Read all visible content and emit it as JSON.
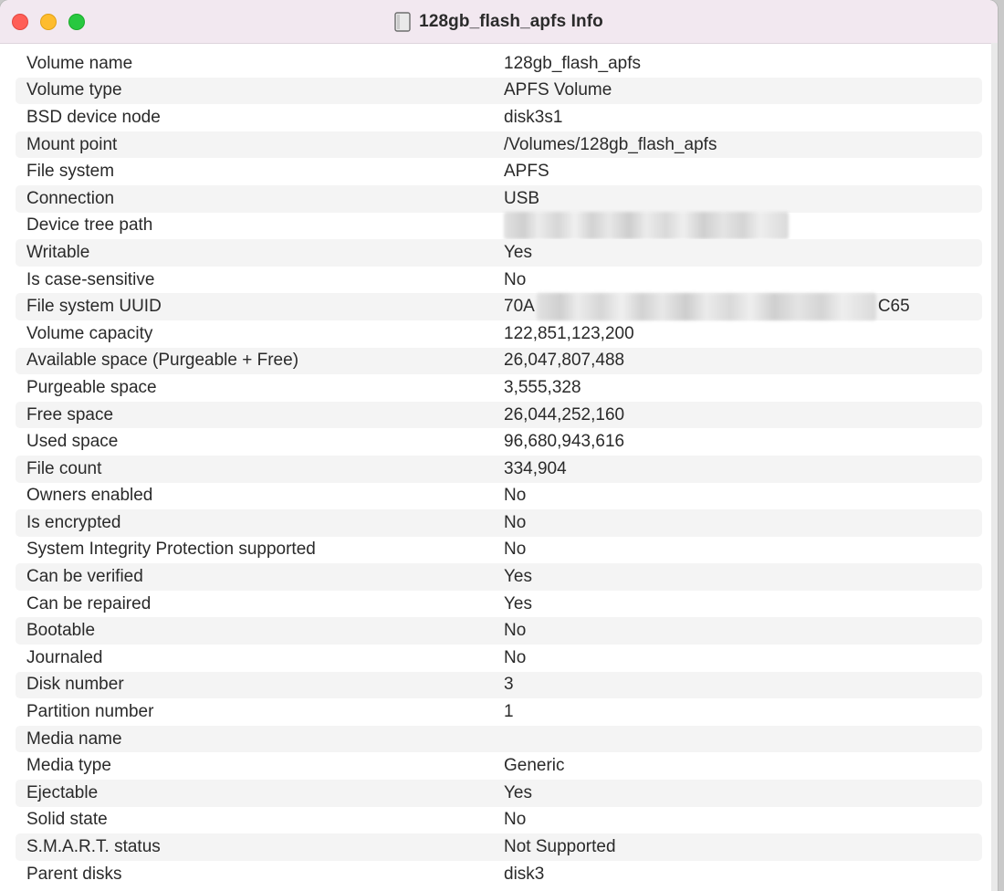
{
  "window": {
    "title": "128gb_flash_apfs Info",
    "title_icon": "document-icon",
    "controls": [
      "close",
      "minimize",
      "zoom"
    ]
  },
  "info_rows": [
    {
      "key": "Volume name",
      "value": "128gb_flash_apfs"
    },
    {
      "key": "Volume type",
      "value": "APFS Volume"
    },
    {
      "key": "BSD device node",
      "value": "disk3s1"
    },
    {
      "key": "Mount point",
      "value": "/Volumes/128gb_flash_apfs"
    },
    {
      "key": "File system",
      "value": "APFS"
    },
    {
      "key": "Connection",
      "value": "USB"
    },
    {
      "key": "Device tree path",
      "value": "",
      "redacted": true
    },
    {
      "key": "Writable",
      "value": "Yes"
    },
    {
      "key": "Is case-sensitive",
      "value": "No"
    },
    {
      "key": "File system UUID",
      "value_prefix": "70A",
      "value_suffix": "C65",
      "redacted": true
    },
    {
      "key": "Volume capacity",
      "value": "122,851,123,200"
    },
    {
      "key": "Available space (Purgeable + Free)",
      "value": "26,047,807,488"
    },
    {
      "key": "Purgeable space",
      "value": "3,555,328"
    },
    {
      "key": "Free space",
      "value": "26,044,252,160"
    },
    {
      "key": "Used space",
      "value": "96,680,943,616"
    },
    {
      "key": "File count",
      "value": "334,904"
    },
    {
      "key": "Owners enabled",
      "value": "No"
    },
    {
      "key": "Is encrypted",
      "value": "No"
    },
    {
      "key": "System Integrity Protection supported",
      "value": "No"
    },
    {
      "key": "Can be verified",
      "value": "Yes"
    },
    {
      "key": "Can be repaired",
      "value": "Yes"
    },
    {
      "key": "Bootable",
      "value": "No"
    },
    {
      "key": "Journaled",
      "value": "No"
    },
    {
      "key": "Disk number",
      "value": "3"
    },
    {
      "key": "Partition number",
      "value": "1"
    },
    {
      "key": "Media name",
      "value": ""
    },
    {
      "key": "Media type",
      "value": "Generic"
    },
    {
      "key": "Ejectable",
      "value": "Yes"
    },
    {
      "key": "Solid state",
      "value": "No"
    },
    {
      "key": "S.M.A.R.T. status",
      "value": "Not Supported"
    },
    {
      "key": "Parent disks",
      "value": "disk3"
    }
  ],
  "colors": {
    "titlebar": "#f2e8f0",
    "alt_row": "#f4f4f4",
    "close": "#ff5f57",
    "minimize": "#febc2e",
    "zoom": "#28c840"
  }
}
